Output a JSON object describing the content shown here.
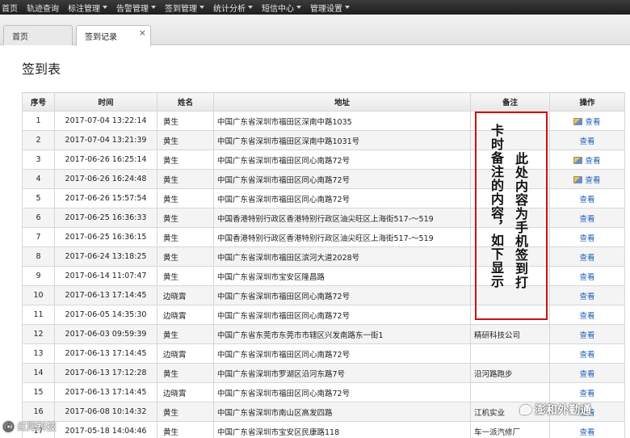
{
  "topnav": {
    "items": [
      {
        "label": "首页",
        "dropdown": false
      },
      {
        "label": "轨迹查询",
        "dropdown": false
      },
      {
        "label": "标注管理",
        "dropdown": true
      },
      {
        "label": "告警管理",
        "dropdown": true
      },
      {
        "label": "签到管理",
        "dropdown": true
      },
      {
        "label": "统计分析",
        "dropdown": true
      },
      {
        "label": "短信中心",
        "dropdown": true
      },
      {
        "label": "管理设置",
        "dropdown": true
      }
    ]
  },
  "tabs": {
    "home": "首页",
    "active": "签到记录",
    "close": "×"
  },
  "page": {
    "title": "签到表"
  },
  "table": {
    "headers": [
      "序号",
      "时间",
      "姓名",
      "地址",
      "备注",
      "操作"
    ],
    "view_label": "查看",
    "rows": [
      {
        "idx": "1",
        "time": "2017-07-04 13:22:14",
        "name": "黄生",
        "address": "中国广东省深圳市福田区深南中路1035",
        "note": "",
        "icon": true
      },
      {
        "idx": "2",
        "time": "2017-07-04 13:21:39",
        "name": "黄生",
        "address": "中国广东省深圳市福田区深南中路1031号",
        "note": "",
        "icon": false
      },
      {
        "idx": "3",
        "time": "2017-06-26 16:25:14",
        "name": "黄生",
        "address": "中国广东省深圳市福田区同心南路72号",
        "note": "",
        "icon": true
      },
      {
        "idx": "4",
        "time": "2017-06-26 16:24:48",
        "name": "黄生",
        "address": "中国广东省深圳市福田区同心南路72号",
        "note": "",
        "icon": true
      },
      {
        "idx": "5",
        "time": "2017-06-26 15:57:54",
        "name": "黄生",
        "address": "中国广东省深圳市福田区同心南路72号",
        "note": "",
        "icon": false
      },
      {
        "idx": "6",
        "time": "2017-06-25 16:36:33",
        "name": "黄生",
        "address": "中国香港特别行政区香港特别行政区油尖旺区上海街517-～519",
        "note": "",
        "icon": false
      },
      {
        "idx": "7",
        "time": "2017-06-25 16:36:15",
        "name": "黄生",
        "address": "中国香港特别行政区香港特别行政区油尖旺区上海街517-～519",
        "note": "",
        "icon": false
      },
      {
        "idx": "8",
        "time": "2017-06-24 13:18:25",
        "name": "黄生",
        "address": "中国广东省深圳市福田区滨河大道2028号",
        "note": "",
        "icon": false
      },
      {
        "idx": "9",
        "time": "2017-06-14 11:07:47",
        "name": "黄生",
        "address": "中国广东省深圳市宝安区隆昌路",
        "note": "",
        "icon": false
      },
      {
        "idx": "10",
        "time": "2017-06-13 17:14:45",
        "name": "边晓霄",
        "address": "中国广东省深圳市福田区同心南路72号",
        "note": "",
        "icon": false
      },
      {
        "idx": "11",
        "time": "2017-06-05 14:35:30",
        "name": "边晓霄",
        "address": "中国广东省深圳市福田区同心南路72号",
        "note": "",
        "icon": false
      },
      {
        "idx": "12",
        "time": "2017-06-03 09:59:39",
        "name": "黄生",
        "address": "中国广东省东莞市东莞市市辖区兴发南路东一街1",
        "note": "精研科技公司",
        "icon": false
      },
      {
        "idx": "13",
        "time": "2017-06-13 17:14:45",
        "name": "边晓霄",
        "address": "中国广东省深圳市福田区同心南路72号",
        "note": "",
        "icon": false
      },
      {
        "idx": "14",
        "time": "2017-06-13 17:12:28",
        "name": "黄生",
        "address": "中国广东省深圳市罗湖区沿河东路7号",
        "note": "沿河路跑步",
        "icon": false
      },
      {
        "idx": "15",
        "time": "2017-06-13 17:14:45",
        "name": "边晓霄",
        "address": "中国广东省深圳市福田区同心南路72号",
        "note": "",
        "icon": false
      },
      {
        "idx": "16",
        "time": "2017-06-08 10:14:32",
        "name": "黄生",
        "address": "中国广东省深圳市南山区高发四路",
        "note": "江机实业",
        "icon": false
      },
      {
        "idx": "17",
        "time": "2017-05-18 14:04:46",
        "name": "黄生",
        "address": "中国广东省深圳市宝安区民康路118",
        "note": "车一派汽修厂",
        "icon": false
      }
    ]
  },
  "annotation": {
    "right_text": "此处内容为手机签到打",
    "left_text": "卡时备注的内容，如下显示",
    "box_color": "#cc1111"
  },
  "watermarks": {
    "left": "©️ 红阳科技",
    "right": "澎和外勤通"
  }
}
